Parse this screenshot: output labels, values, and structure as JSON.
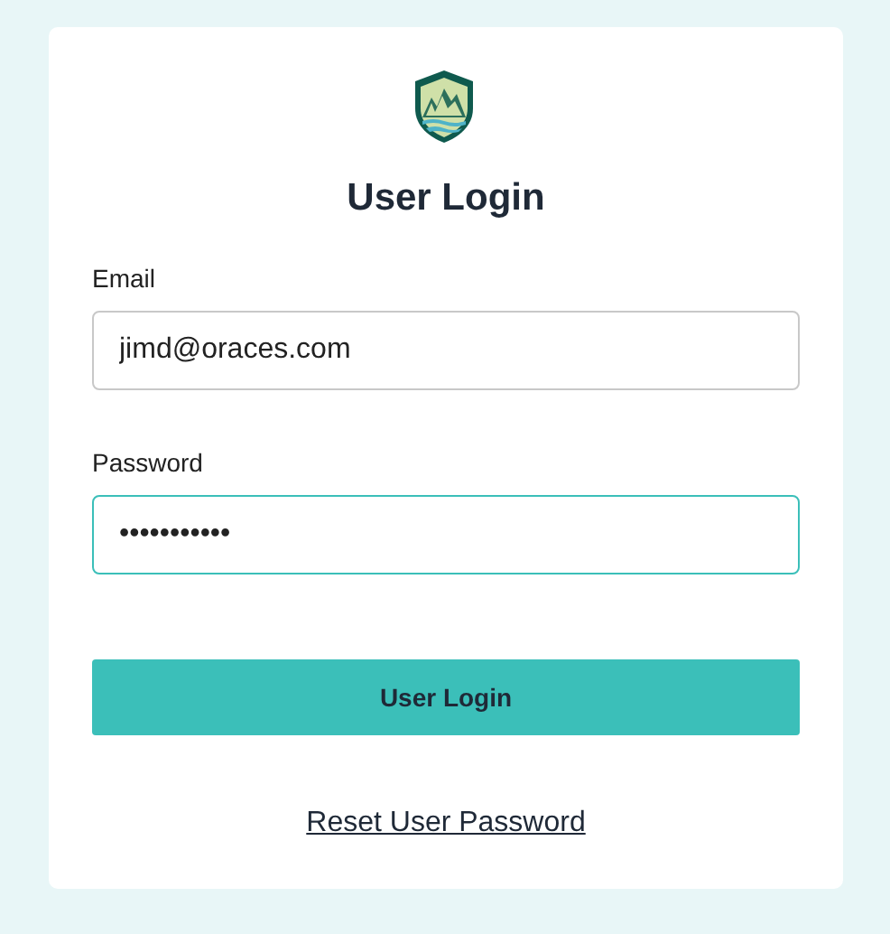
{
  "title": "User Login",
  "fields": [
    {
      "label": "Email",
      "value": "jimd@oraces.com",
      "focused": false
    },
    {
      "label": "Password",
      "value": "•••••••••••",
      "focused": true
    }
  ],
  "submit_button": "User Login",
  "reset_link": "Reset User Password"
}
